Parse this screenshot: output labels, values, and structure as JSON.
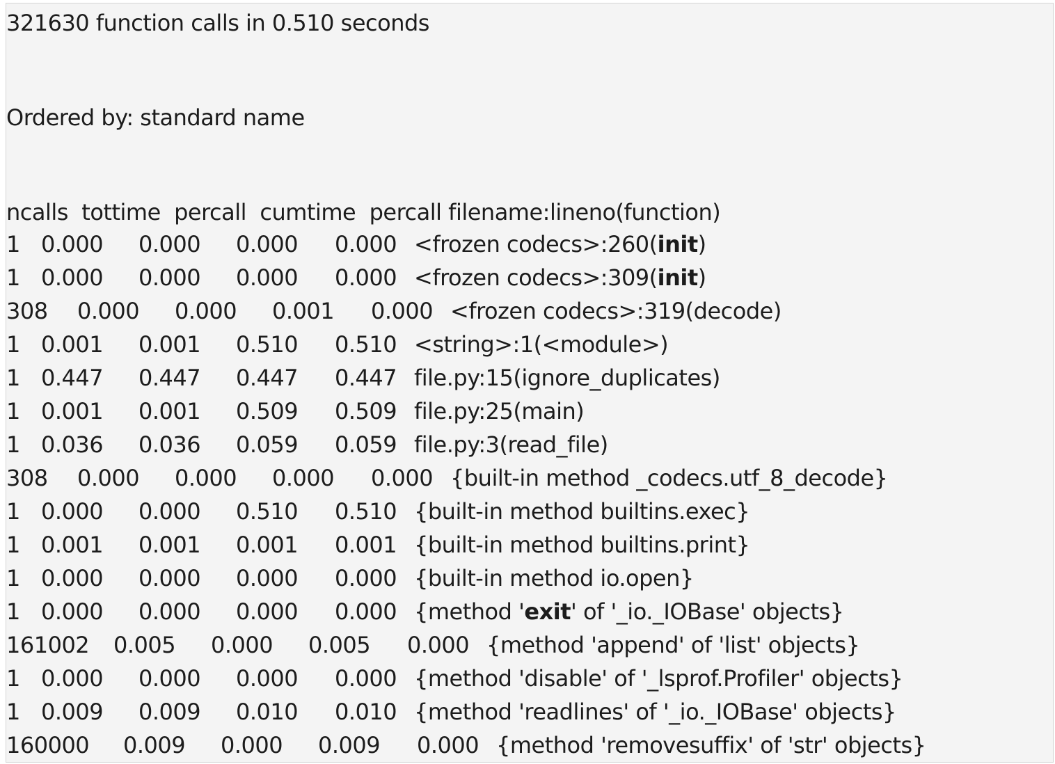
{
  "summary": "321630 function calls in 0.510 seconds",
  "ordered_by": "Ordered by: standard name",
  "header": "ncalls  tottime  percall  cumtime  percall filename:lineno(function)",
  "rows": [
    {
      "ncalls": "1",
      "tottime": "0.000",
      "percall1": "0.000",
      "cumtime": "0.000",
      "percall2": "0.000",
      "fn_pre": "<frozen codecs>:260(",
      "fn_bold": "init",
      "fn_post": ")"
    },
    {
      "ncalls": "1",
      "tottime": "0.000",
      "percall1": "0.000",
      "cumtime": "0.000",
      "percall2": "0.000",
      "fn_pre": "<frozen codecs>:309(",
      "fn_bold": "init",
      "fn_post": ")"
    },
    {
      "ncalls": "308",
      "tottime": "0.000",
      "percall1": "0.000",
      "cumtime": "0.001",
      "percall2": "0.000",
      "fn_pre": "<frozen codecs>:319(decode)",
      "fn_bold": "",
      "fn_post": ""
    },
    {
      "ncalls": "1",
      "tottime": "0.001",
      "percall1": "0.001",
      "cumtime": "0.510",
      "percall2": "0.510",
      "fn_pre": "<string>:1(<module>)",
      "fn_bold": "",
      "fn_post": ""
    },
    {
      "ncalls": "1",
      "tottime": "0.447",
      "percall1": "0.447",
      "cumtime": "0.447",
      "percall2": "0.447",
      "fn_pre": "file.py:15(ignore_duplicates)",
      "fn_bold": "",
      "fn_post": ""
    },
    {
      "ncalls": "1",
      "tottime": "0.001",
      "percall1": "0.001",
      "cumtime": "0.509",
      "percall2": "0.509",
      "fn_pre": "file.py:25(main)",
      "fn_bold": "",
      "fn_post": ""
    },
    {
      "ncalls": "1",
      "tottime": "0.036",
      "percall1": "0.036",
      "cumtime": "0.059",
      "percall2": "0.059",
      "fn_pre": "file.py:3(read_file)",
      "fn_bold": "",
      "fn_post": ""
    },
    {
      "ncalls": "308",
      "tottime": "0.000",
      "percall1": "0.000",
      "cumtime": "0.000",
      "percall2": "0.000",
      "fn_pre": "{built-in method _codecs.utf_8_decode}",
      "fn_bold": "",
      "fn_post": ""
    },
    {
      "ncalls": "1",
      "tottime": "0.000",
      "percall1": "0.000",
      "cumtime": "0.510",
      "percall2": "0.510",
      "fn_pre": "{built-in method builtins.exec}",
      "fn_bold": "",
      "fn_post": ""
    },
    {
      "ncalls": "1",
      "tottime": "0.001",
      "percall1": "0.001",
      "cumtime": "0.001",
      "percall2": "0.001",
      "fn_pre": "{built-in method builtins.print}",
      "fn_bold": "",
      "fn_post": ""
    },
    {
      "ncalls": "1",
      "tottime": "0.000",
      "percall1": "0.000",
      "cumtime": "0.000",
      "percall2": "0.000",
      "fn_pre": "{built-in method io.open}",
      "fn_bold": "",
      "fn_post": ""
    },
    {
      "ncalls": "1",
      "tottime": "0.000",
      "percall1": "0.000",
      "cumtime": "0.000",
      "percall2": "0.000",
      "fn_pre": "{method '",
      "fn_bold": "exit",
      "fn_post": "' of '_io._IOBase' objects}"
    },
    {
      "ncalls": "161002",
      "tottime": "0.005",
      "percall1": "0.000",
      "cumtime": "0.005",
      "percall2": "0.000",
      "fn_pre": "{method 'append' of 'list' objects}",
      "fn_bold": "",
      "fn_post": ""
    },
    {
      "ncalls": "1",
      "tottime": "0.000",
      "percall1": "0.000",
      "cumtime": "0.000",
      "percall2": "0.000",
      "fn_pre": "{method 'disable' of '_lsprof.Profiler' objects}",
      "fn_bold": "",
      "fn_post": ""
    },
    {
      "ncalls": "1",
      "tottime": "0.009",
      "percall1": "0.009",
      "cumtime": "0.010",
      "percall2": "0.010",
      "fn_pre": "{method 'readlines' of '_io._IOBase' objects}",
      "fn_bold": "",
      "fn_post": ""
    },
    {
      "ncalls": "160000",
      "tottime": "0.009",
      "percall1": "0.000",
      "cumtime": "0.009",
      "percall2": "0.000",
      "fn_pre": "{method 'removesuffix' of 'str' objects}",
      "fn_bold": "",
      "fn_post": ""
    }
  ]
}
